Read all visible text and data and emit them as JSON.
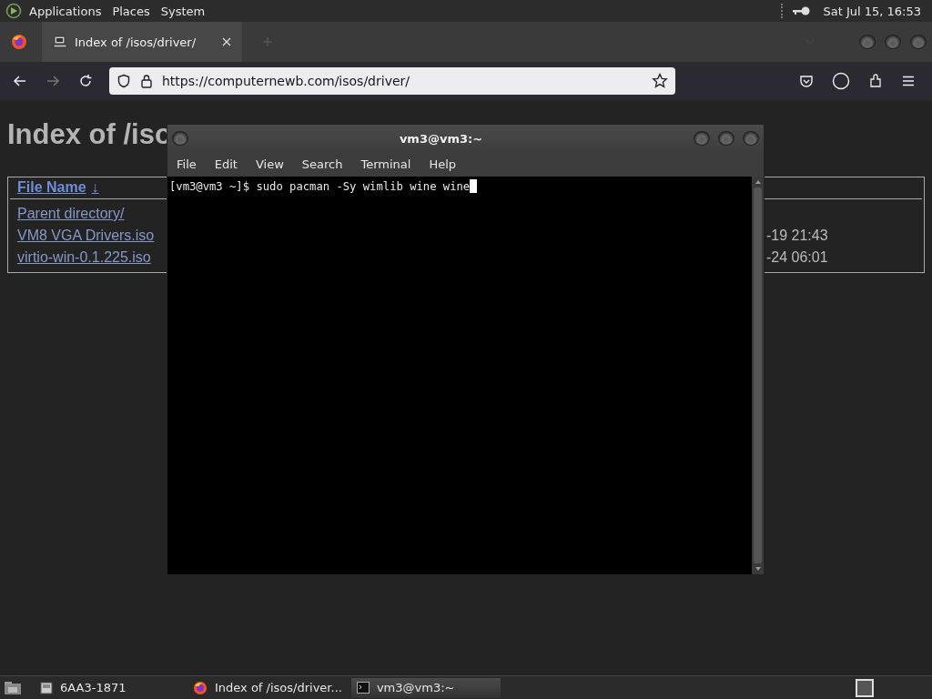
{
  "top_panel": {
    "menus": [
      "Applications",
      "Places",
      "System"
    ],
    "clock": "Sat Jul 15, 16:53"
  },
  "browser": {
    "tabs": [
      {
        "label": "Index of /isos/driver/",
        "selected": true
      }
    ],
    "url": "https://computernewb.com/isos/driver/",
    "page": {
      "heading": "Index of /iso",
      "table": {
        "columns": [
          {
            "label": "File Name",
            "sort": "↓"
          }
        ],
        "rows": [
          {
            "name": "Parent directory/"
          },
          {
            "name": "VM8 VGA Drivers.iso",
            "column_2": "-19 21:43"
          },
          {
            "name": "virtio-win-0.1.225.iso",
            "column_2": "-24 06:01"
          }
        ]
      }
    }
  },
  "terminal": {
    "title": "vm3@vm3:~",
    "menus": [
      "File",
      "Edit",
      "View",
      "Search",
      "Terminal",
      "Help"
    ],
    "lines": [
      "[vm3@vm3 ~]$ sudo pacman -Sy wimlib wine wine"
    ],
    "cursor": true
  },
  "taskbar": {
    "items": [
      {
        "kind": "drive",
        "label": "6AA3-1871",
        "selected": false
      },
      {
        "kind": "browser",
        "label": "Index of /isos/driver...",
        "selected": false
      },
      {
        "kind": "terminal",
        "label": "vm3@vm3:~",
        "selected": true
      }
    ]
  }
}
